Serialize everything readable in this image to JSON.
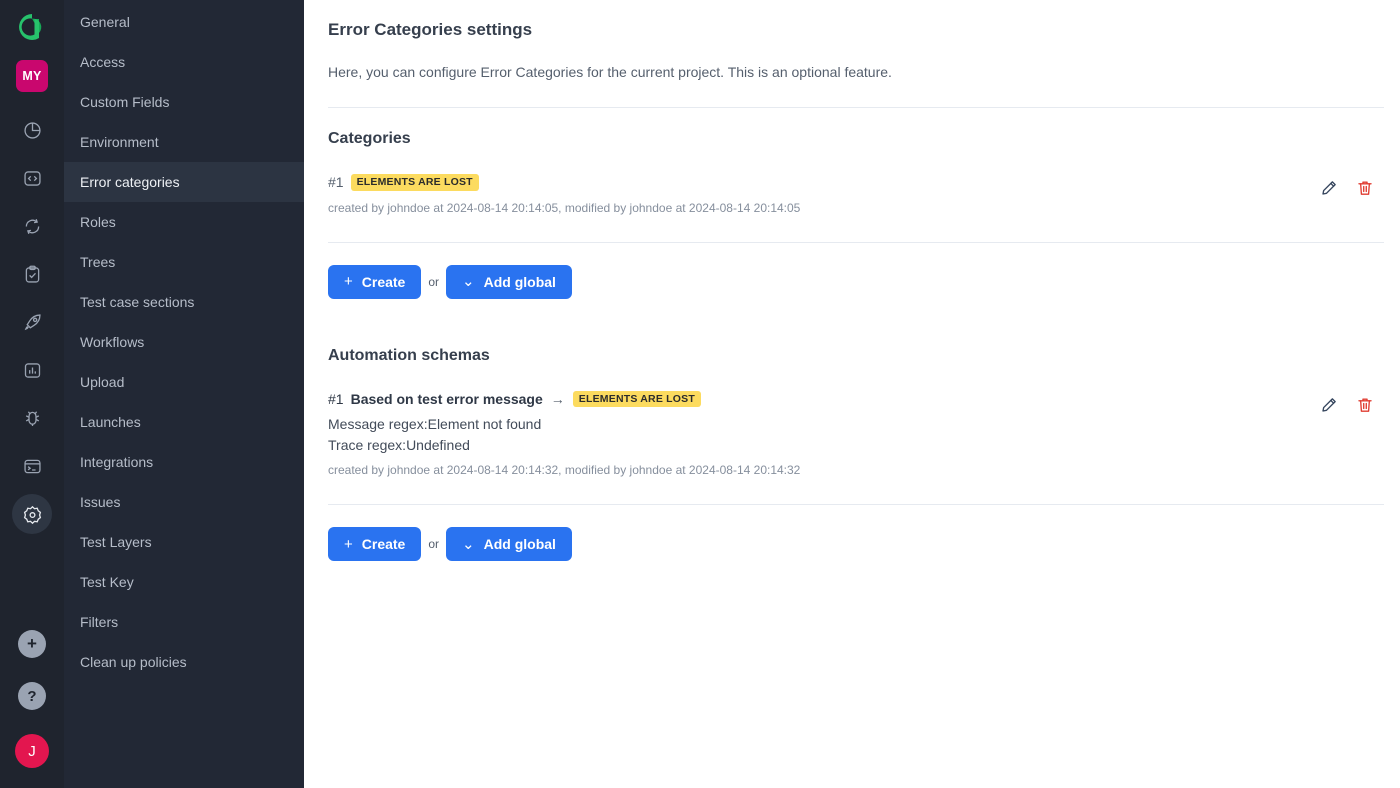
{
  "rail": {
    "logo_name": "allure-logo",
    "project_badge": "MY",
    "icons": [
      {
        "name": "pie-chart-icon",
        "label": "Dashboards"
      },
      {
        "name": "code-icon",
        "label": "API"
      },
      {
        "name": "sync-icon",
        "label": "Jobs"
      },
      {
        "name": "clipboard-check-icon",
        "label": "Test cases"
      },
      {
        "name": "rocket-icon",
        "label": "Launches"
      },
      {
        "name": "bar-chart-icon",
        "label": "Analytics"
      },
      {
        "name": "bug-icon",
        "label": "Defects"
      },
      {
        "name": "terminal-icon",
        "label": "Console"
      },
      {
        "name": "gear-icon",
        "label": "Settings"
      }
    ],
    "add_label": "+",
    "help_label": "?",
    "avatar_initial": "J"
  },
  "nav": {
    "items": [
      {
        "label": "General",
        "active": false
      },
      {
        "label": "Access",
        "active": false
      },
      {
        "label": "Custom Fields",
        "active": false
      },
      {
        "label": "Environment",
        "active": false
      },
      {
        "label": "Error categories",
        "active": true
      },
      {
        "label": "Roles",
        "active": false
      },
      {
        "label": "Trees",
        "active": false
      },
      {
        "label": "Test case sections",
        "active": false
      },
      {
        "label": "Workflows",
        "active": false
      },
      {
        "label": "Upload",
        "active": false
      },
      {
        "label": "Launches",
        "active": false
      },
      {
        "label": "Integrations",
        "active": false
      },
      {
        "label": "Issues",
        "active": false
      },
      {
        "label": "Test Layers",
        "active": false
      },
      {
        "label": "Test Key",
        "active": false
      },
      {
        "label": "Filters",
        "active": false
      },
      {
        "label": "Clean up policies",
        "active": false
      }
    ]
  },
  "page": {
    "title": "Error Categories settings",
    "description": "Here, you can configure Error Categories for the current project. This is an optional feature."
  },
  "categories": {
    "heading": "Categories",
    "items": [
      {
        "index": "#1",
        "badge": "ELEMENTS ARE LOST",
        "meta": "created by johndoe at 2024-08-14 20:14:05, modified by johndoe at 2024-08-14 20:14:05"
      }
    ],
    "create_label": "Create",
    "or_label": "or",
    "add_global_label": "Add global"
  },
  "automation": {
    "heading": "Automation schemas",
    "items": [
      {
        "index": "#1",
        "name": "Based on test error message",
        "arrow": "→",
        "badge": "ELEMENTS ARE LOST",
        "message_regex": "Message regex:Element not found",
        "trace_regex": "Trace regex:Undefined",
        "meta": "created by johndoe at 2024-08-14 20:14:32, modified by johndoe at 2024-08-14 20:14:32"
      }
    ],
    "create_label": "Create",
    "or_label": "or",
    "add_global_label": "Add global"
  },
  "actions": {
    "edit_name": "edit-pencil-icon",
    "delete_name": "delete-trash-icon"
  },
  "colors": {
    "accent_blue": "#2a73f0",
    "badge_yellow": "#fcdb5f",
    "delete_red": "#e03c31",
    "brand_green": "#27c26c",
    "project_magenta": "#c9076e",
    "avatar_crimson": "#e3164f",
    "rail_bg": "#1f242e",
    "nav_bg": "#222835",
    "nav_active_bg": "#2c3442"
  }
}
